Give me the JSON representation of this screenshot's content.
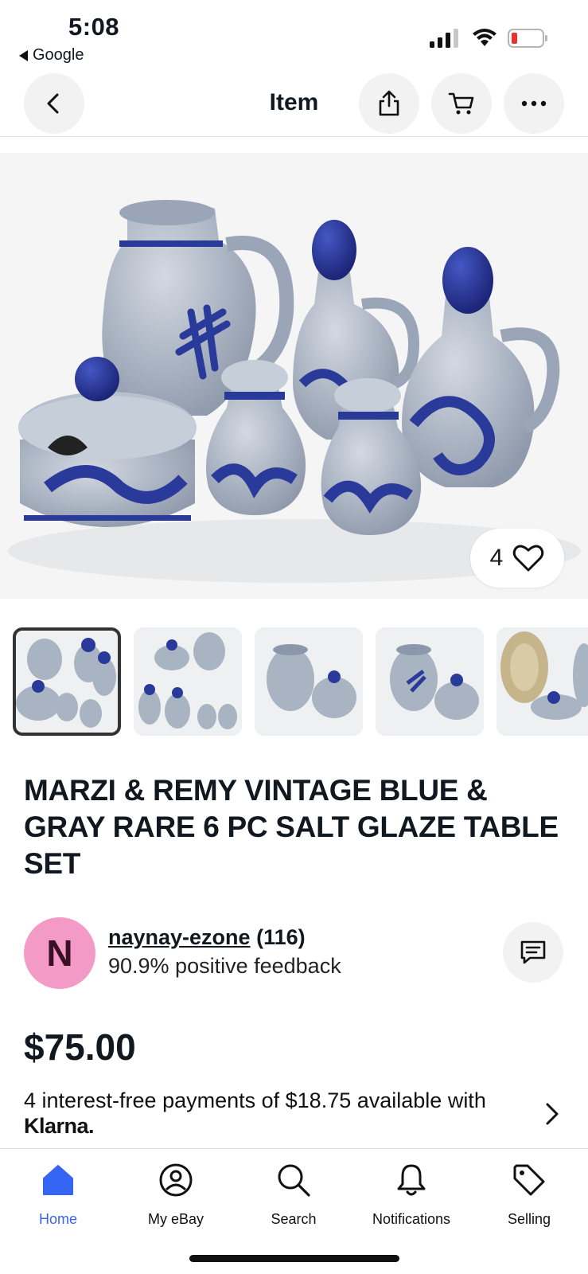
{
  "status": {
    "time": "5:08",
    "back_app": "Google"
  },
  "nav": {
    "title": "Item"
  },
  "hero": {
    "like_count": "4"
  },
  "item": {
    "title": "MARZI & REMY VINTAGE BLUE & GRAY RARE 6 PC SALT GLAZE TABLE SET"
  },
  "seller": {
    "initial": "N",
    "name": "naynay-ezone",
    "count": "(116)",
    "feedback": "90.9% positive feedback"
  },
  "price": {
    "amount": "$75.00",
    "klarna_text": "4 interest-free payments of $18.75 available with",
    "klarna_brand": "Klarna."
  },
  "tabs": [
    {
      "label": "Home",
      "icon": "home-icon",
      "active": true
    },
    {
      "label": "My eBay",
      "icon": "user-icon",
      "active": false
    },
    {
      "label": "Search",
      "icon": "search-icon",
      "active": false
    },
    {
      "label": "Notifications",
      "icon": "bell-icon",
      "active": false
    },
    {
      "label": "Selling",
      "icon": "tag-icon",
      "active": false
    }
  ],
  "colors": {
    "accent": "#3665f3",
    "avatar": "#f49ac7",
    "pottery_blue": "#2a3a9a",
    "pottery_gray": "#a9b4c2"
  }
}
